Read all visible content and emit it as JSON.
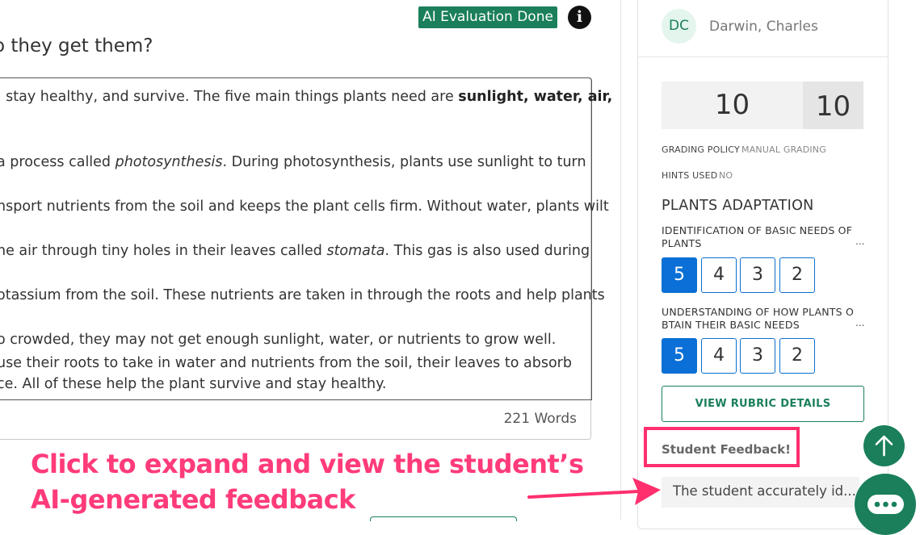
{
  "header": {
    "status_badge": "AI Evaluation Done",
    "info_icon": "info-icon"
  },
  "question": {
    "title_fragment": "o they get them?"
  },
  "answer": {
    "lines": [
      {
        "pre": ", stay healthy, and survive. The five main things plants need are ",
        "bold": "sunlight, water, air,",
        "post": ""
      },
      {
        "pre": "a process called ",
        "italic": "photosynthesis",
        "post": ". During photosynthesis, plants use sunlight to turn"
      },
      {
        "pre": "nsport nutrients from the soil and keeps the plant cells firm. Without water, plants wilt"
      },
      {
        "pre": "he air through tiny holes in their leaves called ",
        "italic": "stomata",
        "post": ". This gas is also used during"
      },
      {
        "pre": "otassium from the soil. These nutrients are taken in through the roots and help plants"
      },
      {
        "pre": "o crowded, they may not get enough sunlight, water, or nutrients to grow well."
      },
      {
        "pre": " use their roots to take in water and nutrients from the soil, their leaves to absorb"
      },
      {
        "pre": "ce. All of these help the plant survive and stay healthy."
      }
    ],
    "word_count": "221 Words"
  },
  "annotation": {
    "line1": "Click to expand and view the student’s",
    "line2": "AI-generated feedback",
    "color": "#ff3b7a"
  },
  "student": {
    "initials": "DC",
    "name": "Darwin, Charles"
  },
  "score": {
    "earned": "10",
    "total": "10"
  },
  "meta": {
    "grading_policy_label": "GRADING POLICY",
    "grading_policy_value": "MANUAL GRADING",
    "hints_used_label": "HINTS USED",
    "hints_used_value": "NO"
  },
  "rubric": {
    "title": "PLANTS ADAPTATION",
    "criteria": [
      {
        "line1": "IDENTIFICATION OF BASIC NEEDS OF",
        "line2": "PLANTS",
        "more": "...",
        "options": [
          "5",
          "4",
          "3",
          "2"
        ],
        "selected": "5"
      },
      {
        "line1": "UNDERSTANDING OF HOW PLANTS O",
        "line2": "BTAIN THEIR BASIC NEEDS",
        "more": "...",
        "options": [
          "5",
          "4",
          "3",
          "2"
        ],
        "selected": "5"
      }
    ],
    "details_button": "VIEW RUBRIC DETAILS"
  },
  "feedback": {
    "label": "Student Feedback!",
    "preview": "The student accurately id..."
  },
  "colors": {
    "brand_green": "#1a7f5a",
    "selected_blue": "#0a6fd6",
    "highlight_pink": "#ff2f6e"
  }
}
